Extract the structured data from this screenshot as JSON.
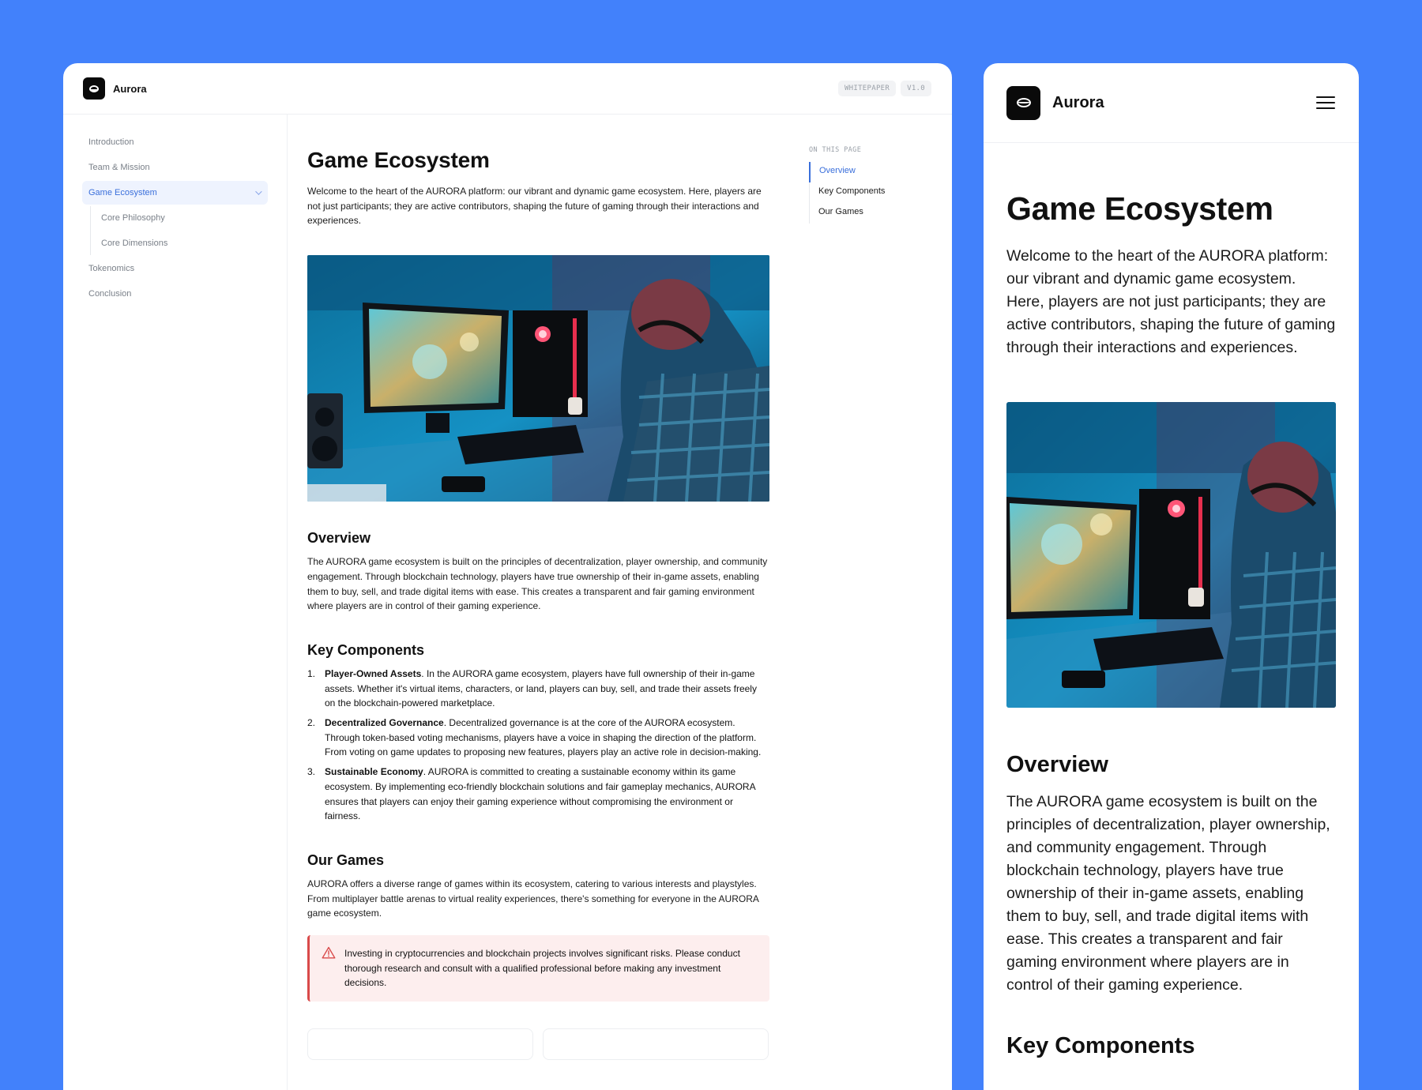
{
  "brand": {
    "name": "Aurora"
  },
  "header": {
    "tag_whitepaper": "WHITEPAPER",
    "tag_version": "V1.0"
  },
  "sidebar": {
    "items": [
      {
        "label": "Introduction"
      },
      {
        "label": "Team & Mission"
      },
      {
        "label": "Game Ecosystem"
      },
      {
        "label": "Tokenomics"
      },
      {
        "label": "Conclusion"
      }
    ],
    "subitems": [
      {
        "label": "Core Philosophy"
      },
      {
        "label": "Core Dimensions"
      }
    ]
  },
  "toc": {
    "label": "ON THIS PAGE",
    "items": [
      {
        "label": "Overview"
      },
      {
        "label": "Key Components"
      },
      {
        "label": "Our Games"
      }
    ]
  },
  "content": {
    "title": "Game Ecosystem",
    "intro": "Welcome to the heart of the AURORA platform: our vibrant and dynamic game ecosystem. Here, players are not just participants; they are active contributors, shaping the future of gaming through their interactions and experiences.",
    "overview_heading": "Overview",
    "overview_text": "The AURORA game ecosystem is built on the principles of decentralization, player ownership, and community engagement. Through blockchain technology, players have true ownership of their in-game assets, enabling them to buy, sell, and trade digital items with ease. This creates a transparent and fair gaming environment where players are in control of their gaming experience.",
    "key_heading": "Key Components",
    "key_items": [
      {
        "num": "1.",
        "title": "Player-Owned Assets",
        "text": ". In the AURORA game ecosystem, players have full ownership of their in-game assets. Whether it's virtual items, characters, or land, players can buy, sell, and trade their assets freely on the blockchain-powered marketplace."
      },
      {
        "num": "2.",
        "title": "Decentralized Governance",
        "text": ". Decentralized governance is at the core of the AURORA ecosystem. Through token-based voting mechanisms, players have a voice in shaping the direction of the platform. From voting on game updates to proposing new features, players play an active role in decision-making."
      },
      {
        "num": "3.",
        "title": "Sustainable Economy",
        "text": ". AURORA is committed to creating a sustainable economy within its game ecosystem. By implementing eco-friendly blockchain solutions and fair gameplay mechanics, AURORA ensures that players can enjoy their gaming experience without compromising the environment or fairness."
      }
    ],
    "games_heading": "Our Games",
    "games_text": "AURORA offers a diverse range of games within its ecosystem, catering to various interests and playstyles. From multiplayer battle arenas to virtual reality experiences, there's something for everyone in the AURORA game ecosystem.",
    "alert_text": "Investing in cryptocurrencies and blockchain projects involves significant risks. Please conduct thorough research and consult with a qualified professional before making any investment decisions.",
    "mobile_key_heading": "Key Components"
  },
  "icons": {
    "logo": "coin-logo-icon",
    "menu": "hamburger-menu-icon",
    "warning": "warning-triangle-icon",
    "chevron": "chevron-down-icon"
  },
  "colors": {
    "background": "#4281fb",
    "accent": "#3a6fdb",
    "alert_bg": "#fdeeee",
    "alert_border": "#d94a4a"
  }
}
